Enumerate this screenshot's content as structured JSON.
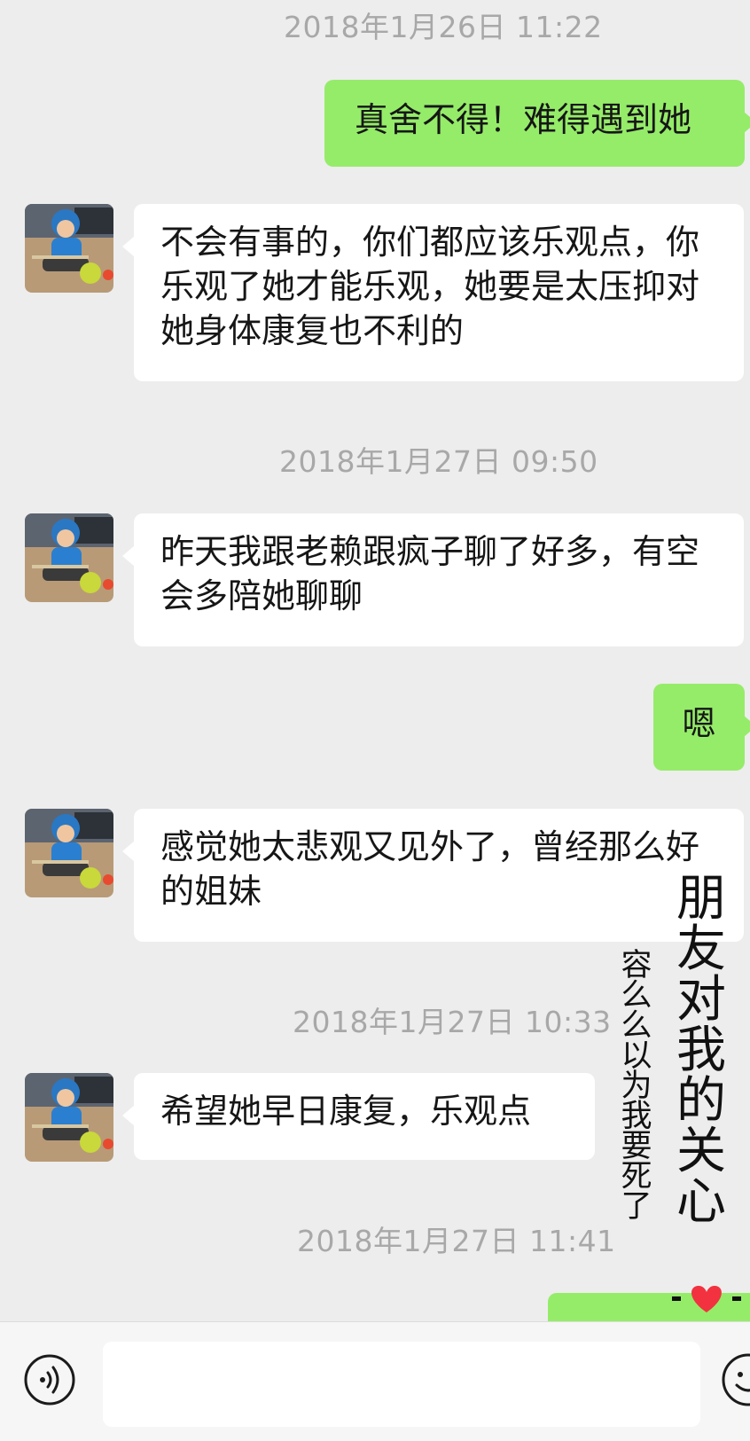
{
  "timestamps": [
    "2018年1月26日 11:22",
    "2018年1月27日 09:50",
    "2018年1月27日 10:33",
    "2018年1月27日 11:41"
  ],
  "messages": [
    {
      "side": "out",
      "text": "真舍不得！难得遇到她"
    },
    {
      "side": "in",
      "text": "不会有事的，你们都应该乐观点，你乐观了她才能乐观，她要是太压抑对她身体康复也不利的"
    },
    {
      "side": "in",
      "text": "昨天我跟老赖跟疯子聊了好多，有空会多陪她聊聊"
    },
    {
      "side": "out",
      "text": "嗯"
    },
    {
      "side": "in",
      "text": "感觉她太悲观又见外了，曾经那么好的姐妹"
    },
    {
      "side": "in",
      "text": "希望她早日康复，乐观点"
    }
  ],
  "overlay": {
    "big_text": "朋友对我的关心",
    "small_text": "容么么以为我要死了"
  },
  "input": {
    "value": "",
    "placeholder": ""
  },
  "icons": {
    "voice": "voice-icon",
    "emoji": "emoji-icon",
    "heart": "heart-icon"
  },
  "colors": {
    "background": "#ededed",
    "outgoing_bubble": "#95ec69",
    "incoming_bubble": "#ffffff",
    "timestamp_text": "#a8a8a8",
    "heart": "#f2323f"
  }
}
